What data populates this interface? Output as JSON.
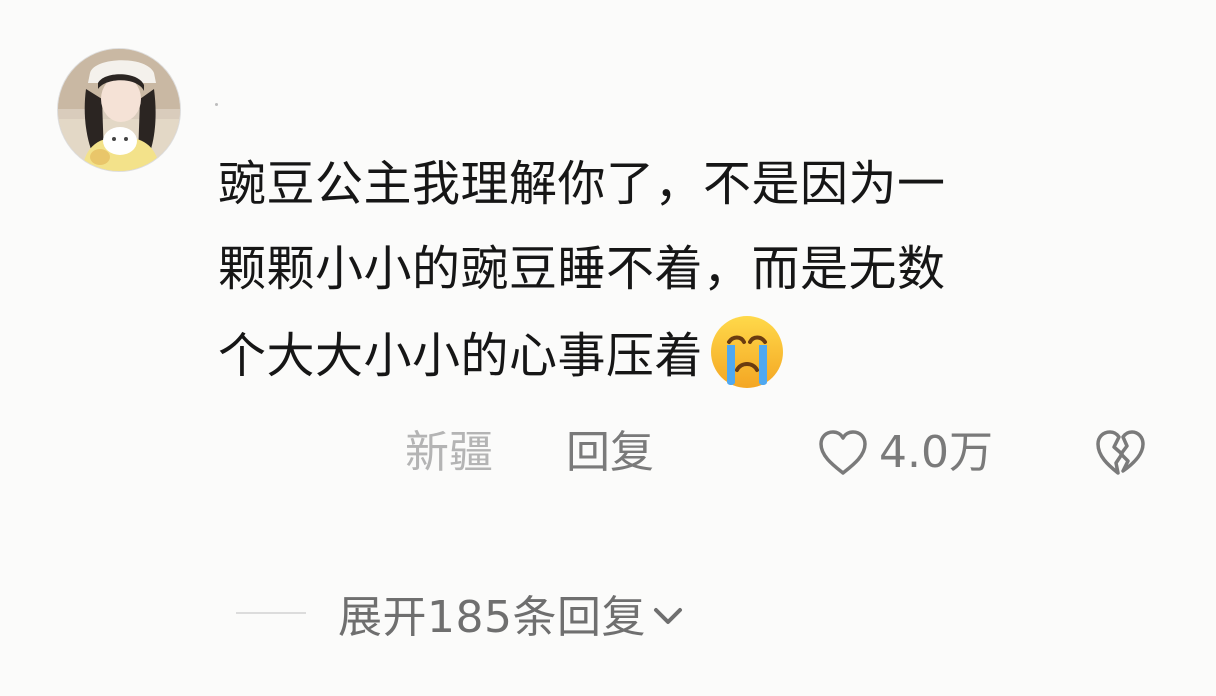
{
  "comment": {
    "lines": [
      "豌豆公主我理解你了，不是因为一",
      "颗颗小小的豌豆睡不着，而是无数",
      "个大大小小的心事压着"
    ],
    "emoji": "crying-face-emoji"
  },
  "meta": {
    "region": "新疆",
    "reply_label": "回复",
    "like_count": "4.0万"
  },
  "replies": {
    "expand_label": "展开185条回复"
  },
  "icons": {
    "like": "heart-outline-icon",
    "dislike": "broken-heart-icon",
    "expand": "chevron-down-icon"
  },
  "colors": {
    "background": "#fbfbfa",
    "text": "#161616",
    "muted": "#7a7a7a",
    "region": "#b4b4b4"
  }
}
